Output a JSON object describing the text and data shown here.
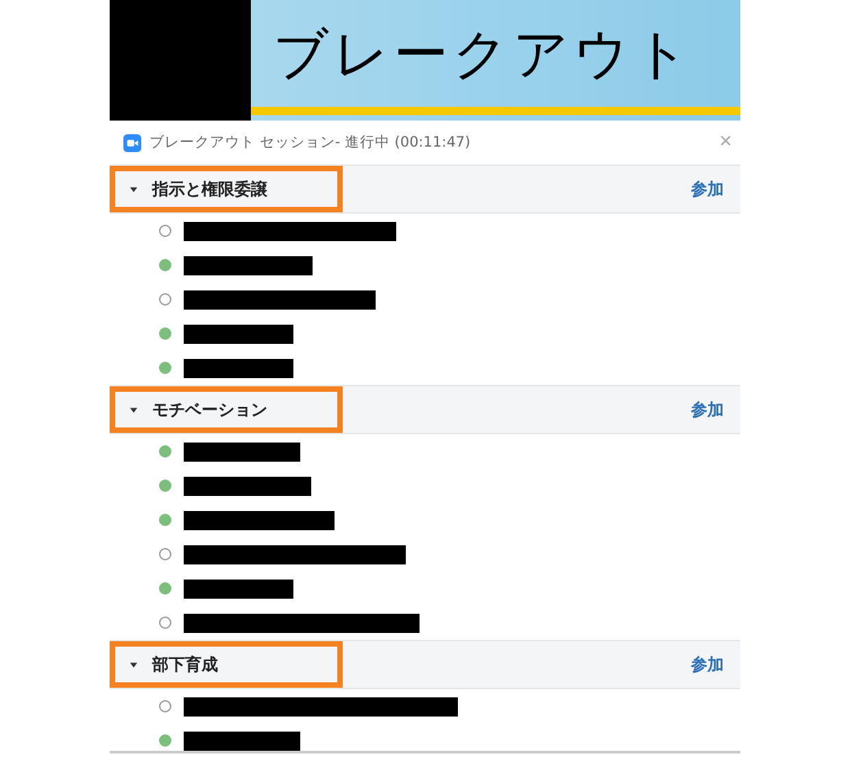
{
  "banner": {
    "title": "ブレークアウト"
  },
  "window": {
    "title": "ブレークアウト セッション- 進行中 (00:11:47)",
    "close": "×"
  },
  "rooms": [
    {
      "name": "指示と権限委譲",
      "highlighted": true,
      "expanded": true,
      "join": "参加",
      "members": [
        {
          "joined": false
        },
        {
          "joined": true
        },
        {
          "joined": false
        },
        {
          "joined": true
        },
        {
          "joined": true
        }
      ]
    },
    {
      "name": "モチベーション",
      "highlighted": true,
      "expanded": true,
      "join": "参加",
      "members": [
        {
          "joined": true
        },
        {
          "joined": true
        },
        {
          "joined": true
        },
        {
          "joined": false
        },
        {
          "joined": true
        },
        {
          "joined": false
        }
      ]
    },
    {
      "name": "部下育成",
      "highlighted": true,
      "expanded": true,
      "join": "参加",
      "members": [
        {
          "joined": false
        },
        {
          "joined": true
        }
      ]
    }
  ]
}
